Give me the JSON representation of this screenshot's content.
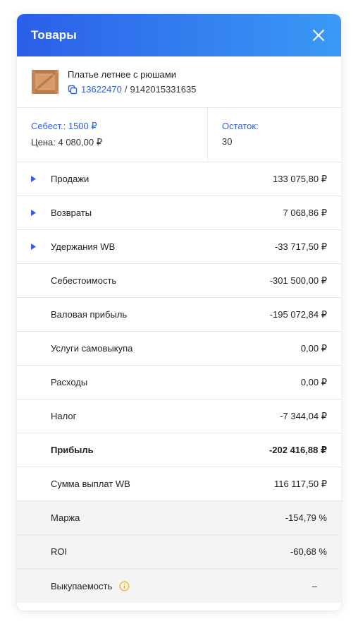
{
  "header": {
    "title": "Товары"
  },
  "product": {
    "name": "Платье летнее с рюшами",
    "article": "13622470",
    "separator": "/",
    "barcode": "9142015331635"
  },
  "info": {
    "cost_link": "Себест.: 1500 ₽",
    "price": "Цена: 4 080,00 ₽",
    "stock_label": "Остаток:",
    "stock_value": "30"
  },
  "rows": [
    {
      "label": "Продажи",
      "value": "133 075,80 ₽",
      "expandable": true
    },
    {
      "label": "Возвраты",
      "value": "7 068,86 ₽",
      "expandable": true
    },
    {
      "label": "Удержания WB",
      "value": "-33 717,50 ₽",
      "expandable": true
    },
    {
      "label": "Себестоимость",
      "value": "-301 500,00 ₽"
    },
    {
      "label": "Валовая прибыль",
      "value": "-195 072,84 ₽"
    },
    {
      "label": "Услуги самовыкупа",
      "value": "0,00 ₽"
    },
    {
      "label": "Расходы",
      "value": "0,00 ₽"
    },
    {
      "label": "Налог",
      "value": "-7 344,04 ₽"
    },
    {
      "label": "Прибыль",
      "value": "-202 416,88 ₽",
      "bold": true
    },
    {
      "label": "Сумма выплат WB",
      "value": "116 117,50 ₽"
    },
    {
      "label": "Маржа",
      "value": "-154,79 %",
      "shaded": true
    },
    {
      "label": "ROI",
      "value": "-60,68 %",
      "shaded": true
    },
    {
      "label": "Выкупаемость",
      "value": "–",
      "shaded": true,
      "info": true
    }
  ],
  "colors": {
    "accent": "#2f5fe0",
    "header_start": "#2b5ee8",
    "header_end": "#3a9af6",
    "info_icon": "#e8b21e"
  },
  "icons": {
    "close": "close-icon",
    "copy": "copy-icon",
    "expand": "triangle-right-icon",
    "info": "info-icon",
    "thumbnail": "product-box-image"
  }
}
